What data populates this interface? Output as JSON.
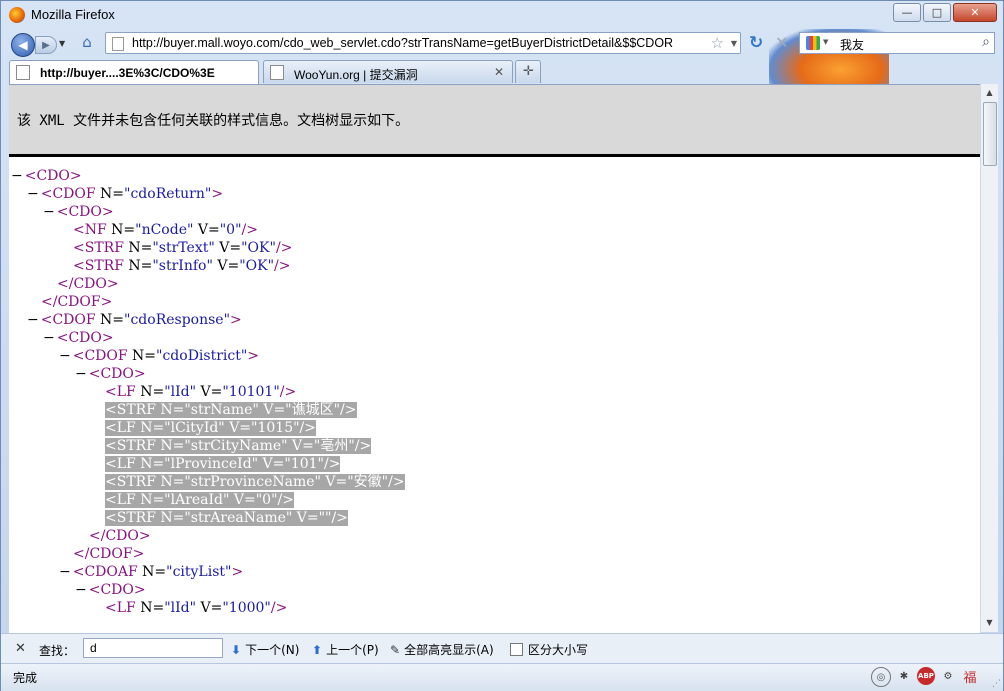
{
  "window": {
    "title": "Mozilla Firefox",
    "controls": {
      "minimize": "—",
      "maximize": "□",
      "close": "✕"
    }
  },
  "navbar": {
    "url": "http://buyer.mall.woyo.com/cdo_web_servlet.cdo?strTransName=getBuyerDistrictDetail&$$CDOR",
    "search_value": "我友"
  },
  "tabs": [
    {
      "label": "http://buyer....3E%3C/CDO%3E",
      "active": true
    },
    {
      "label": "WooYun.org | 提交漏洞",
      "active": false
    }
  ],
  "xml_info": "该 XML 文件并未包含任何关联的样式信息。文档树显示如下。",
  "xml_tree": {
    "l1": "<CDO>",
    "l2": {
      "tag": "<CDOF",
      "attr": " N=",
      "val": "\"cdoReturn\"",
      "end": ">"
    },
    "l3": "<CDO>",
    "l4": {
      "tag": "<NF",
      "attr": " N=",
      "val": "\"nCode\"",
      "attr2": " V=",
      "val2": "\"0\"",
      "end": "/>"
    },
    "l5": {
      "tag": "<STRF",
      "attr": " N=",
      "val": "\"strText\"",
      "attr2": " V=",
      "val2": "\"OK\"",
      "end": "/>"
    },
    "l6": {
      "tag": "<STRF",
      "attr": " N=",
      "val": "\"strInfo\"",
      "attr2": " V=",
      "val2": "\"OK\"",
      "end": "/>"
    },
    "l7": "</CDO>",
    "l8": "</CDOF>",
    "l9": {
      "tag": "<CDOF",
      "attr": " N=",
      "val": "\"cdoResponse\"",
      "end": ">"
    },
    "l10": "<CDO>",
    "l11": {
      "tag": "<CDOF",
      "attr": " N=",
      "val": "\"cdoDistrict\"",
      "end": ">"
    },
    "l12": "<CDO>",
    "l13": {
      "tag": "<LF",
      "attr": " N=",
      "val": "\"lId\"",
      "attr2": " V=",
      "val2": "\"10101\"",
      "end": "/>"
    },
    "l14": "<STRF N=\"strName\" V=\"谯城区\"/>",
    "l15": "<LF N=\"lCityId\" V=\"1015\"/>",
    "l16": "<STRF N=\"strCityName\" V=\"亳州\"/>",
    "l17": "<LF N=\"lProvinceId\" V=\"101\"/>",
    "l18": "<STRF N=\"strProvinceName\" V=\"安徽\"/>",
    "l19": "<LF N=\"lAreaId\" V=\"0\"/>",
    "l20": "<STRF N=\"strAreaName\" V=\"\"/>",
    "l21": "</CDO>",
    "l22": "</CDOF>",
    "l23": {
      "tag": "<CDOAF",
      "attr": " N=",
      "val": "\"cityList\"",
      "end": ">"
    },
    "l24": "<CDO>",
    "l25": {
      "tag": "<LF",
      "attr": " N=",
      "val": "\"lId\"",
      "attr2": " V=",
      "val2": "\"1000\"",
      "end": "/>"
    }
  },
  "findbar": {
    "label": "查找：",
    "value": "d",
    "next": "下一个(N)",
    "prev": "上一个(P)",
    "highlight_all": "全部高亮显示(A)",
    "match_case": "区分大小写"
  },
  "status": "完成",
  "colors": {
    "tag": "#881280",
    "value": "#1a1aa6",
    "selection": "#a7a7a7"
  }
}
